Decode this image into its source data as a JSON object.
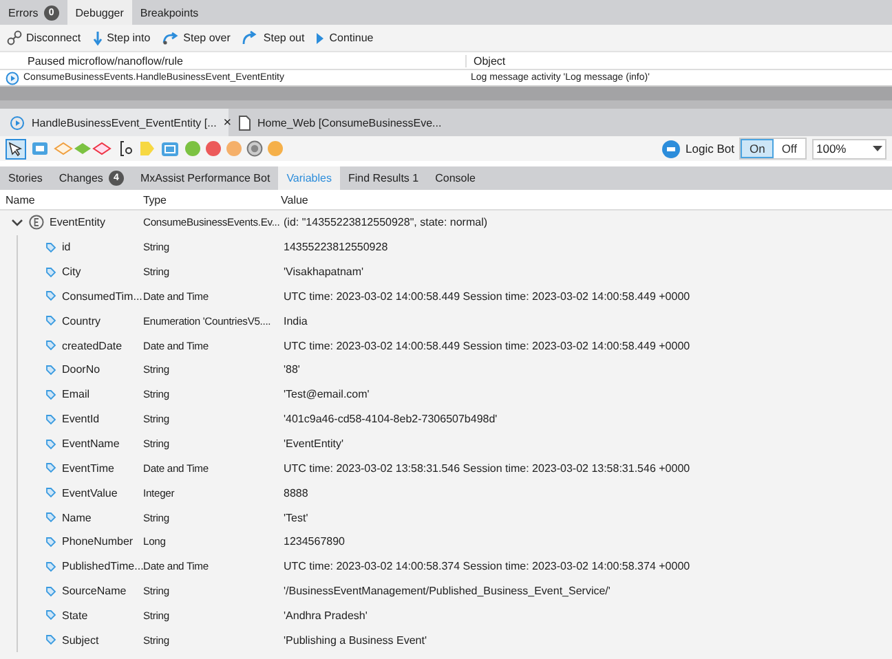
{
  "top_tabs": [
    {
      "label": "Errors",
      "badge": "0",
      "selected": false
    },
    {
      "label": "Debugger",
      "selected": true
    },
    {
      "label": "Breakpoints",
      "selected": false
    }
  ],
  "toolbar": [
    {
      "label": "Disconnect",
      "kind": "disconnect"
    },
    {
      "label": "Step into",
      "kind": "into"
    },
    {
      "label": "Step over",
      "kind": "over"
    },
    {
      "label": "Step out",
      "kind": "out"
    },
    {
      "label": "Continue",
      "kind": "continue"
    }
  ],
  "paused": {
    "columns": [
      "Paused microflow/nanoflow/rule",
      "Object"
    ],
    "rows": [
      {
        "flow": "ConsumeBusinessEvents.HandleBusinessEvent_EventEntity",
        "object": "Log message activity 'Log message (info)'"
      }
    ]
  },
  "editor_tabs": [
    {
      "label": "HandleBusinessEvent_EventEntity [...",
      "kind": "flow",
      "selected": true,
      "close": "×"
    },
    {
      "label": "Home_Web [ConsumeBusinessEve...",
      "kind": "page",
      "selected": false
    }
  ],
  "logic_bot": {
    "label": "Logic Bot",
    "options": [
      {
        "label": "On",
        "selected": true
      },
      {
        "label": "Off",
        "selected": false
      }
    ]
  },
  "zoom": "100%",
  "bottom_tabs": [
    {
      "label": "Stories",
      "selected": false
    },
    {
      "label": "Changes",
      "badge": "4",
      "selected": false
    },
    {
      "label": "MxAssist Performance Bot",
      "selected": false
    },
    {
      "label": "Variables",
      "selected": true
    },
    {
      "label": "Find Results 1",
      "selected": false
    },
    {
      "label": "Console",
      "selected": false
    }
  ],
  "variables": {
    "columns": [
      "Name",
      "Type",
      "Value"
    ],
    "rows": [
      {
        "name": "EventEntity",
        "type": "ConsumeBusinessEvents.Ev...",
        "value": "(id: \"14355223812550928\", state: normal)",
        "expanded": true,
        "children": [
          {
            "name": "id",
            "type": "String",
            "value": "14355223812550928"
          },
          {
            "name": "City",
            "type": "String",
            "value": "'Visakhapatnam'"
          },
          {
            "name": "ConsumedTim...",
            "type": "Date and Time",
            "value": "UTC time: 2023-03-02 14:00:58.449 Session time: 2023-03-02 14:00:58.449 +0000"
          },
          {
            "name": "Country",
            "type": "Enumeration 'CountriesV5....",
            "value": "India"
          },
          {
            "name": "createdDate",
            "type": "Date and Time",
            "value": "UTC time: 2023-03-02 14:00:58.449 Session time: 2023-03-02 14:00:58.449 +0000"
          },
          {
            "name": "DoorNo",
            "type": "String",
            "value": "'88'"
          },
          {
            "name": "Email",
            "type": "String",
            "value": "'Test@email.com'"
          },
          {
            "name": "EventId",
            "type": "String",
            "value": "'401c9a46-cd58-4104-8eb2-7306507b498d'"
          },
          {
            "name": "EventName",
            "type": "String",
            "value": "'EventEntity'"
          },
          {
            "name": "EventTime",
            "type": "Date and Time",
            "value": "UTC time: 2023-03-02 13:58:31.546 Session time: 2023-03-02 13:58:31.546 +0000"
          },
          {
            "name": "EventValue",
            "type": "Integer",
            "value": "8888"
          },
          {
            "name": "Name",
            "type": "String",
            "value": "'Test'"
          },
          {
            "name": "PhoneNumber",
            "type": "Long",
            "value": "1234567890"
          },
          {
            "name": "PublishedTime...",
            "type": "Date and Time",
            "value": "UTC time: 2023-03-02 14:00:58.374 Session time: 2023-03-02 14:00:58.374 +0000"
          },
          {
            "name": "SourceName",
            "type": "String",
            "value": "'/BusinessEventManagement/Published_Business_Event_Service/'"
          },
          {
            "name": "State",
            "type": "String",
            "value": "'Andhra Pradesh'"
          },
          {
            "name": "Subject",
            "type": "String",
            "value": "'Publishing a Business Event'"
          }
        ]
      }
    ]
  }
}
